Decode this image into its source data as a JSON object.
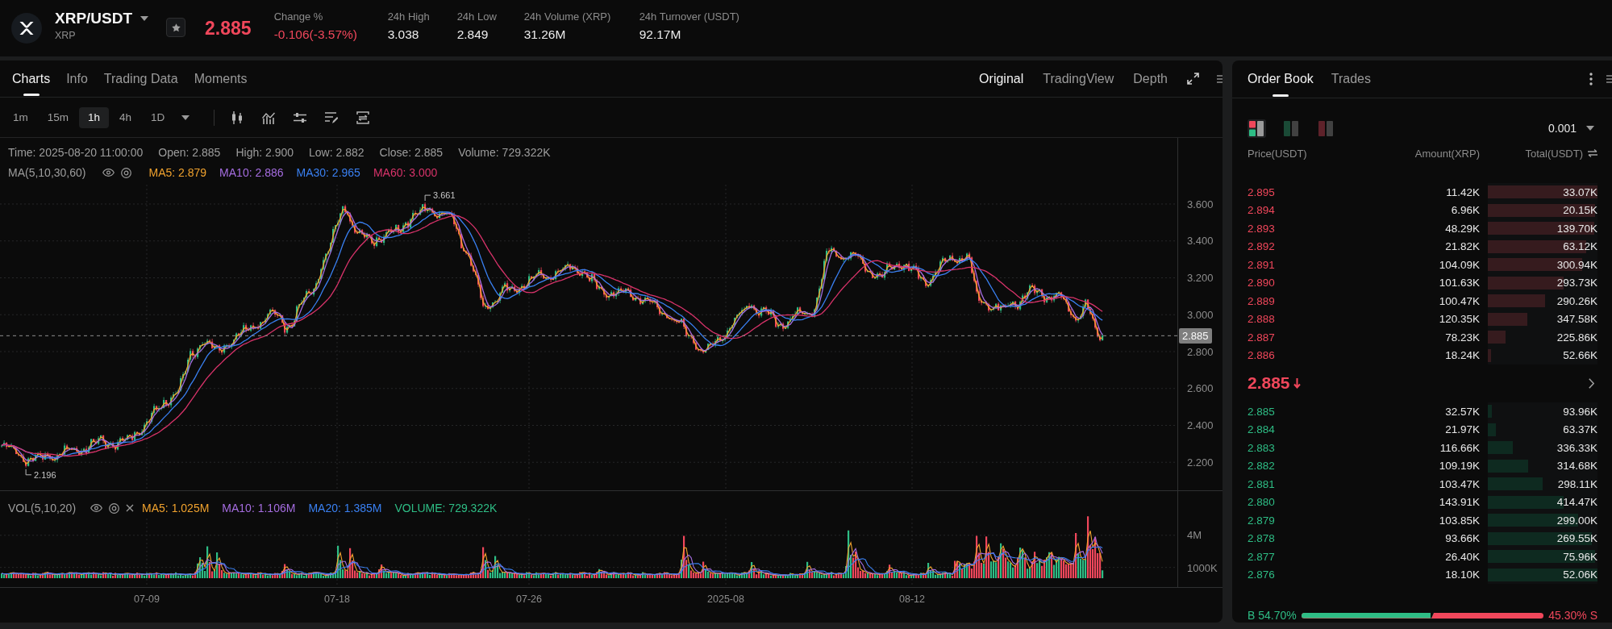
{
  "header": {
    "pair": "XRP/USDT",
    "base_asset": "XRP",
    "last_price": "2.885",
    "falling": true,
    "stats": [
      {
        "label": "Change %",
        "value": "-0.106(-3.57%)",
        "falling": true
      },
      {
        "label": "24h High",
        "value": "3.038"
      },
      {
        "label": "24h Low",
        "value": "2.849"
      },
      {
        "label": "24h Volume (XRP)",
        "value": "31.26M"
      },
      {
        "label": "24h Turnover (USDT)",
        "value": "92.17M"
      }
    ]
  },
  "chart_tabs": [
    {
      "label": "Charts",
      "selected": true
    },
    {
      "label": "Info",
      "selected": false
    },
    {
      "label": "Trading Data",
      "selected": false
    },
    {
      "label": "Moments",
      "selected": false
    }
  ],
  "view_tabs": [
    {
      "label": "Original",
      "selected": true
    },
    {
      "label": "TradingView",
      "selected": false
    },
    {
      "label": "Depth",
      "selected": false
    }
  ],
  "intervals": [
    {
      "label": "1m",
      "selected": false
    },
    {
      "label": "15m",
      "selected": false
    },
    {
      "label": "1h",
      "selected": true
    },
    {
      "label": "4h",
      "selected": false
    },
    {
      "label": "1D",
      "selected": false
    }
  ],
  "price_chart": {
    "ohlc_legend": [
      "Time: 2025-08-20 11:00:00",
      "Open: 2.885",
      "High: 2.900",
      "Low: 2.882",
      "Close: 2.885",
      "Volume: 729.322K"
    ],
    "indicator": {
      "title": "MA(5,10,30,60)",
      "items": [
        {
          "text": "MA5: 2.879",
          "color": "#f0a22e"
        },
        {
          "text": "MA10: 2.886",
          "color": "#a56de0"
        },
        {
          "text": "MA30: 2.965",
          "color": "#3a80f2"
        },
        {
          "text": "MA60: 3.000",
          "color": "#d8336a"
        }
      ]
    },
    "y_axis_labels": [
      "3.600",
      "3.400",
      "3.200",
      "3.000",
      "2.800",
      "2.600",
      "2.400",
      "2.200"
    ],
    "last_price_tag": "2.885",
    "high_label": "3.661",
    "low_label": "2.196"
  },
  "volume_chart": {
    "indicator": {
      "title": "VOL(5,10,20)",
      "items": [
        {
          "text": "MA5: 1.025M",
          "color": "#f0a22e"
        },
        {
          "text": "MA10: 1.106M",
          "color": "#a56de0"
        },
        {
          "text": "MA20: 1.385M",
          "color": "#3a80f2"
        },
        {
          "text": "VOLUME: 729.322K",
          "color": "#2ebd85"
        }
      ]
    },
    "y_axis_labels": [
      "4M",
      "1000K"
    ]
  },
  "x_axis_labels": [
    "07-09",
    "07-18",
    "07-26",
    "2025-08",
    "08-12"
  ],
  "order_book": {
    "tabs": [
      {
        "label": "Order Book",
        "selected": true
      },
      {
        "label": "Trades",
        "selected": false
      }
    ],
    "modes": [
      {
        "kind": "both",
        "selected": true
      },
      {
        "kind": "bids",
        "selected": false
      },
      {
        "kind": "asks",
        "selected": false
      }
    ],
    "precision": "0.001",
    "columns": [
      "Price(USDT)",
      "Amount(XRP)",
      "Total(USDT)"
    ],
    "asks": [
      {
        "price": "2.895",
        "amount": "11.42K",
        "total": "33.07K",
        "level": 1
      },
      {
        "price": "2.894",
        "amount": "6.96K",
        "total": "20.15K",
        "level": 0.98
      },
      {
        "price": "2.893",
        "amount": "48.29K",
        "total": "139.70K",
        "level": 0.97
      },
      {
        "price": "2.892",
        "amount": "21.82K",
        "total": "63.12K",
        "level": 0.9
      },
      {
        "price": "2.891",
        "amount": "104.09K",
        "total": "300.94K",
        "level": 0.86
      },
      {
        "price": "2.890",
        "amount": "101.63K",
        "total": "293.73K",
        "level": 0.69
      },
      {
        "price": "2.889",
        "amount": "100.47K",
        "total": "290.26K",
        "level": 0.52
      },
      {
        "price": "2.888",
        "amount": "120.35K",
        "total": "347.58K",
        "level": 0.36
      },
      {
        "price": "2.887",
        "amount": "78.23K",
        "total": "225.86K",
        "level": 0.16
      },
      {
        "price": "2.886",
        "amount": "18.24K",
        "total": "52.66K",
        "level": 0.03
      }
    ],
    "mid_price": {
      "value": "2.885",
      "falling": true
    },
    "bids": [
      {
        "price": "2.885",
        "amount": "32.57K",
        "total": "93.96K",
        "level": 0.04
      },
      {
        "price": "2.884",
        "amount": "21.97K",
        "total": "63.37K",
        "level": 0.07
      },
      {
        "price": "2.883",
        "amount": "116.66K",
        "total": "336.33K",
        "level": 0.23
      },
      {
        "price": "2.882",
        "amount": "109.19K",
        "total": "314.68K",
        "level": 0.37
      },
      {
        "price": "2.881",
        "amount": "103.47K",
        "total": "298.11K",
        "level": 0.5
      },
      {
        "price": "2.880",
        "amount": "143.91K",
        "total": "414.47K",
        "level": 0.69
      },
      {
        "price": "2.879",
        "amount": "103.85K",
        "total": "299.00K",
        "level": 0.82
      },
      {
        "price": "2.878",
        "amount": "93.66K",
        "total": "269.55K",
        "level": 0.95
      },
      {
        "price": "2.877",
        "amount": "26.40K",
        "total": "75.96K",
        "level": 0.98
      },
      {
        "price": "2.876",
        "amount": "18.10K",
        "total": "52.06K",
        "level": 1
      }
    ],
    "ratio": {
      "buy_label": "B 54.70%",
      "sell_label": "45.30% S",
      "level": 0.547
    }
  }
}
